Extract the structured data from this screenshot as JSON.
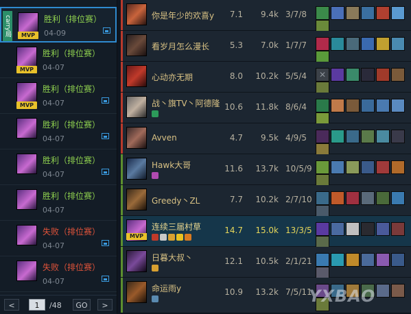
{
  "matches": [
    {
      "result": "胜利（排位赛）",
      "outcome": "win",
      "date": "04-09",
      "selected": true,
      "carry": "carry局",
      "mvp": true,
      "has_pic": true
    },
    {
      "result": "胜利（排位赛）",
      "outcome": "win",
      "date": "04-07",
      "mvp": true,
      "has_pic": false
    },
    {
      "result": "胜利（排位赛）",
      "outcome": "win",
      "date": "04-07",
      "mvp": true,
      "has_pic": true
    },
    {
      "result": "胜利（排位赛）",
      "outcome": "win",
      "date": "04-07",
      "mvp": false,
      "has_pic": true
    },
    {
      "result": "胜利（排位赛）",
      "outcome": "win",
      "date": "04-07",
      "mvp": false,
      "has_pic": true
    },
    {
      "result": "胜利（排位赛）",
      "outcome": "win",
      "date": "04-07",
      "mvp": false,
      "has_pic": false
    },
    {
      "result": "失败（排位赛）",
      "outcome": "loss",
      "date": "04-07",
      "mvp": false,
      "has_pic": true
    },
    {
      "result": "失败（排位赛）",
      "outcome": "loss",
      "date": "04-07",
      "mvp": false,
      "has_pic": true
    }
  ],
  "mvp_label": "MVP",
  "pager": {
    "prev": "<",
    "current": "1",
    "total": "/48",
    "go": "GO",
    "next": ">"
  },
  "players": [
    {
      "name": "你是年少的欢喜y",
      "score": "7.1",
      "damage": "9.4k",
      "kda": "3/7/8",
      "team": "red",
      "highlight": false
    },
    {
      "name": "看岁月怎么漫长",
      "score": "5.3",
      "damage": "7.0k",
      "kda": "1/7/7",
      "team": "red",
      "highlight": false
    },
    {
      "name": "心动亦无期",
      "score": "8.0",
      "damage": "10.2k",
      "kda": "5/5/4",
      "team": "red",
      "highlight": false
    },
    {
      "name": "战丶旗TV丶阿德隆",
      "score": "10.6",
      "damage": "11.8k",
      "kda": "8/6/4",
      "team": "red",
      "highlight": false
    },
    {
      "name": "Avven",
      "score": "4.7",
      "damage": "9.5k",
      "kda": "4/9/5",
      "team": "red",
      "highlight": false
    },
    {
      "name": "Hawk大哥",
      "score": "11.6",
      "damage": "13.7k",
      "kda": "10/5/9",
      "team": "green",
      "highlight": false
    },
    {
      "name": "Greedy丶ZL",
      "score": "7.7",
      "damage": "10.2k",
      "kda": "2/7/10",
      "team": "green",
      "highlight": false
    },
    {
      "name": "连续三届村草",
      "score": "14.7",
      "damage": "15.0k",
      "kda": "13/3/5",
      "team": "green",
      "highlight": true,
      "mvp": true
    },
    {
      "name": "日暮大叔丶",
      "score": "12.1",
      "damage": "10.5k",
      "kda": "2/1/21",
      "team": "green",
      "highlight": false
    },
    {
      "name": "命运雨y",
      "score": "10.9",
      "damage": "13.2k",
      "kda": "7/5/11",
      "team": "green",
      "highlight": false
    }
  ],
  "watermark": "YXBAO"
}
